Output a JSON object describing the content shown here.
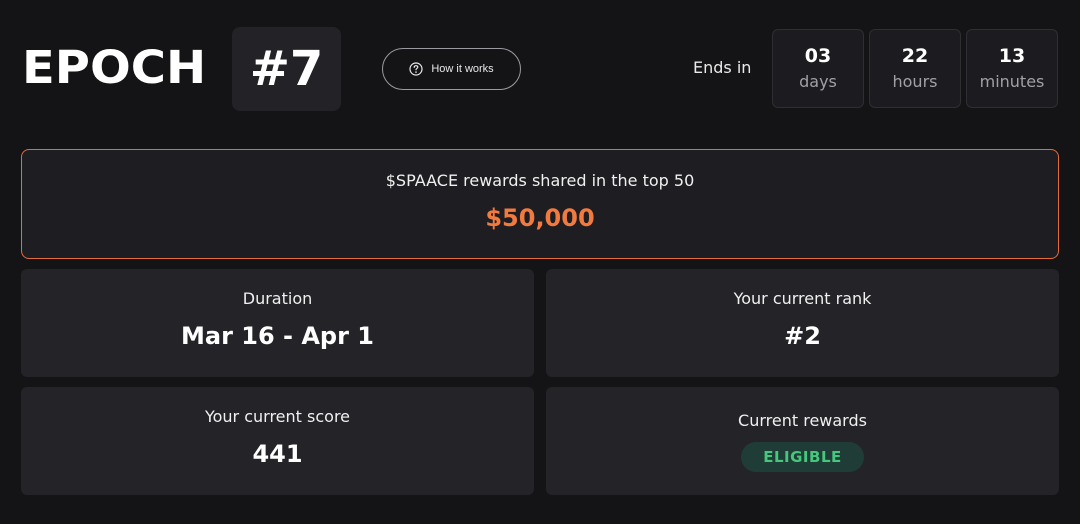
{
  "header": {
    "title": "EPOCH",
    "epoch_number": "#7",
    "how_it_works_label": "How it works",
    "ends_in_label": "Ends in"
  },
  "countdown": [
    {
      "value": "03",
      "unit": "days"
    },
    {
      "value": "22",
      "unit": "hours"
    },
    {
      "value": "13",
      "unit": "minutes"
    }
  ],
  "rewards_banner": {
    "label": "$SPAACE rewards shared in the top 50",
    "amount": "$50,000"
  },
  "cards": {
    "duration": {
      "label": "Duration",
      "value": "Mar 16 - Apr 1"
    },
    "rank": {
      "label": "Your current rank",
      "value": "#2"
    },
    "score": {
      "label": "Your current score",
      "value": "441"
    },
    "rewards": {
      "label": "Current rewards",
      "badge": "ELIGIBLE"
    }
  },
  "colors": {
    "background": "#141416",
    "accent_orange": "#f07a3f",
    "eligible_green": "#46c77d",
    "eligible_bg": "#1f3d36"
  },
  "icons": {
    "how_it_works": "question-circle-icon"
  }
}
